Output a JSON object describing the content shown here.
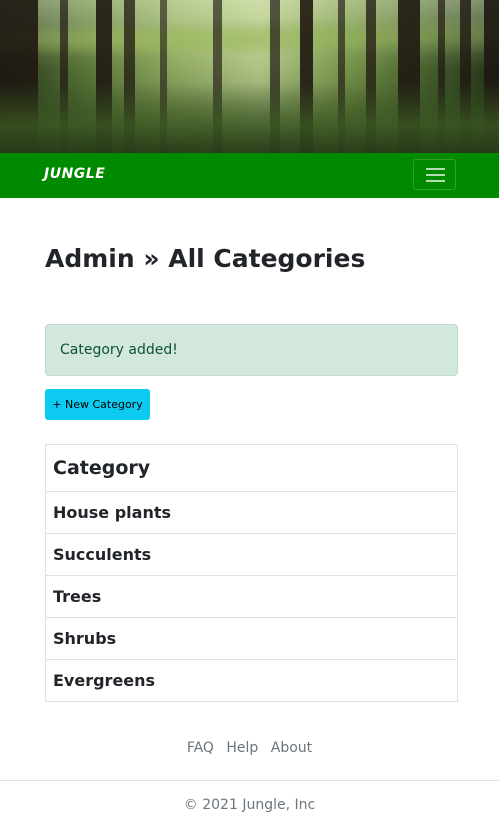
{
  "navbar": {
    "brand": "JUNGLE",
    "color": "#008a00",
    "toggler_icon": "hamburger-menu-icon"
  },
  "main": {
    "title": "Admin » All Categories",
    "alert": "Category added!",
    "new_button": "+ New Category",
    "table": {
      "header": "Category",
      "rows": [
        "House plants",
        "Succulents",
        "Trees",
        "Shrubs",
        "Evergreens"
      ]
    }
  },
  "footer": {
    "links": [
      "FAQ",
      "Help",
      "About"
    ],
    "copyright": "© 2021 Jungle, Inc"
  }
}
